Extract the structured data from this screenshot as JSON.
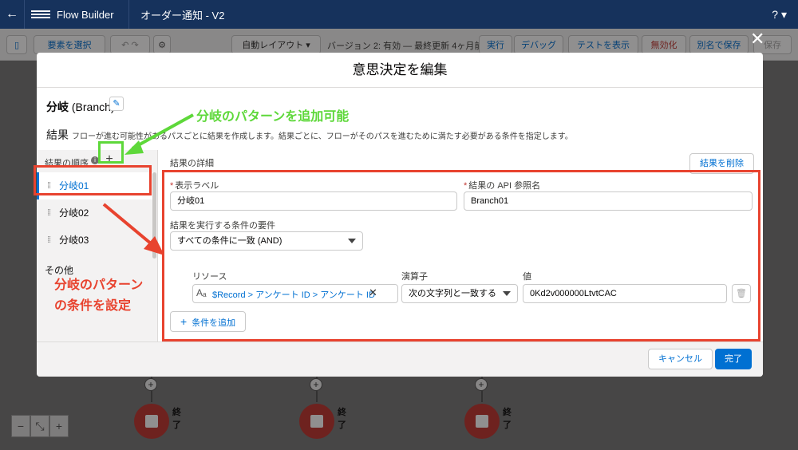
{
  "appbar": {
    "app_name": "Flow Builder",
    "flow_name": "オーダー通知 - V2",
    "help": "?"
  },
  "toolbar": {
    "select_elements": "要素を選択",
    "auto_layout": "自動レイアウト",
    "version_info": "バージョン 2: 有効 — 最終更新 4ヶ月前",
    "run": "実行",
    "debug": "デバッグ",
    "view_tests": "テストを表示",
    "deactivate": "無効化",
    "save_as": "別名で保存",
    "save": "保存"
  },
  "canvas": {
    "end_label": "終了"
  },
  "modal": {
    "title": "意思決定を編集",
    "node_name": "分岐",
    "node_api": "(Branch)",
    "results_heading": "結果",
    "results_description": "フローが進む可能性があるパスごとに結果を作成します。結果ごとに、フローがそのパスを進むために満たす必要がある条件を指定します。",
    "outcome_order_label": "結果の順序",
    "outcomes": [
      "分岐01",
      "分岐02",
      "分岐03"
    ],
    "other_label": "その他",
    "detail_title": "結果の詳細",
    "delete_outcome": "結果を削除",
    "label_field": {
      "label": "表示ラベル",
      "value": "分岐01"
    },
    "api_field": {
      "label": "結果の API 参照名",
      "value": "Branch01"
    },
    "requirement": {
      "label": "結果を実行する条件の要件",
      "value": "すべての条件に一致 (AND)"
    },
    "condition": {
      "resource_label": "リソース",
      "operator_label": "演算子",
      "value_label": "値",
      "resource": "$Record > アンケート ID > アンケート ID",
      "operator": "次の文字列と一致する",
      "value": "0Kd2v000000LtvtCAC"
    },
    "add_condition": "条件を追加",
    "cancel": "キャンセル",
    "done": "完了"
  },
  "annotations": {
    "green_text": "分岐のパターンを追加可能",
    "red_text_1": "分岐のパターン",
    "red_text_2": "の条件を設定"
  },
  "colors": {
    "header": "#16325c",
    "brand": "#0070d2",
    "annotation_red": "#e8432f",
    "annotation_green": "#5ed83a",
    "end_node": "#c23934"
  }
}
